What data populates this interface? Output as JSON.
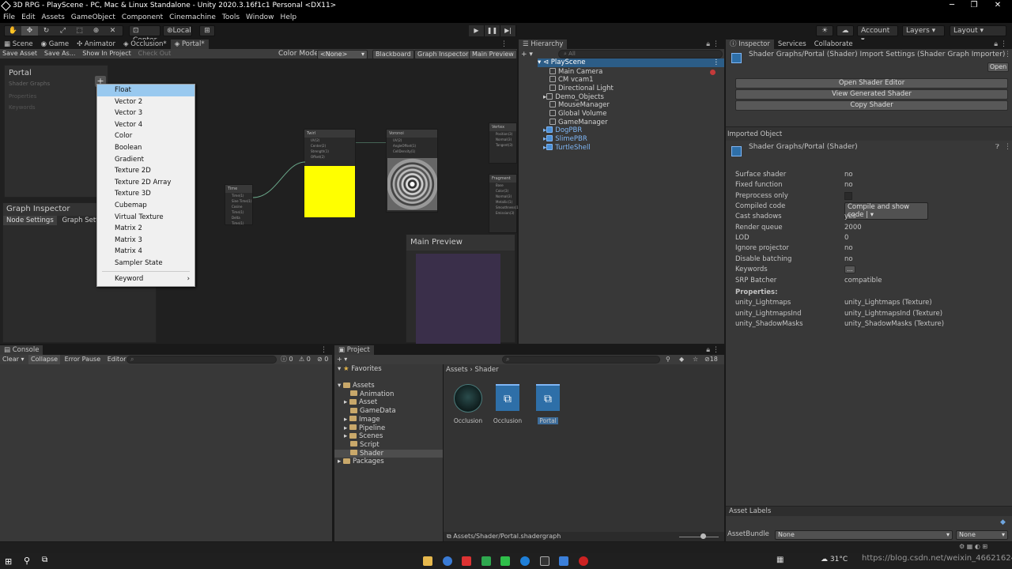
{
  "window": {
    "title": "3D RPG - PlayScene - PC, Mac & Linux Standalone - Unity 2020.3.16f1c1 Personal <DX11>",
    "controls": [
      "─",
      "❐",
      "✕"
    ]
  },
  "menu": [
    "File",
    "Edit",
    "Assets",
    "GameObject",
    "Component",
    "Cinemachine",
    "Tools",
    "Window",
    "Help"
  ],
  "toolbar": {
    "pivot": "Center",
    "space": "Local",
    "account": "Account",
    "layers": "Layers",
    "layout": "Layout"
  },
  "left_tabs": [
    "Scene",
    "Game",
    "Animator",
    "Occlusion*",
    "Portal*"
  ],
  "shader_graph": {
    "save_asset": "Save Asset",
    "save_as": "Save As...",
    "show_in_project": "Show In Project",
    "check_out": "Check Out",
    "color_mode_label": "Color Mode",
    "color_mode_value": "<None>",
    "blackboard": "Blackboard",
    "graph_inspector": "Graph Inspector",
    "main_preview": "Main Preview",
    "blackboard_title": "Portal",
    "blackboard_subtitle": "Shader Graphs",
    "blackboard_properties": "Properties",
    "blackboard_keywords": "Keywords",
    "blackboard_add": "+",
    "inspector_title": "Graph Inspector",
    "inspector_tabs": [
      "Node Settings",
      "Graph Settings"
    ],
    "main_preview_title": "Main Preview",
    "nodes": {
      "twirl": "Twirl",
      "voronoi": "Voronoi",
      "time": "Time",
      "vertex": "Vertex",
      "fragment": "Fragment"
    }
  },
  "context_menu": {
    "items": [
      "Float",
      "Vector 2",
      "Vector 3",
      "Vector 4",
      "Color",
      "Boolean",
      "Gradient",
      "Texture 2D",
      "Texture 2D Array",
      "Texture 3D",
      "Cubemap",
      "Virtual Texture",
      "Matrix 2",
      "Matrix 3",
      "Matrix 4",
      "Sampler State"
    ],
    "keyword": "Keyword",
    "keyword_arrow": "›"
  },
  "hierarchy": {
    "tab": "Hierarchy",
    "search_placeholder": "All",
    "scene": "PlayScene",
    "items": [
      "Main Camera",
      "CM vcam1",
      "Directional Light",
      "Demo_Objects",
      "MouseManager",
      "Global Volume",
      "GameManager",
      "DogPBR",
      "SlimePBR",
      "TurtleShell"
    ]
  },
  "inspector": {
    "tabs": [
      "Inspector",
      "Services",
      "Collaborate"
    ],
    "header": "Shader Graphs/Portal (Shader) Import Settings (Shader Graph Importer)",
    "open": "Open",
    "buttons": [
      "Open Shader Editor",
      "View Generated Shader",
      "Copy Shader"
    ],
    "imported_object": "Imported Object",
    "shader_title": "Shader Graphs/Portal (Shader)",
    "rows": [
      {
        "label": "Surface shader",
        "value": "no"
      },
      {
        "label": "Fixed function",
        "value": "no"
      },
      {
        "label": "Preprocess only",
        "value": ""
      },
      {
        "label": "Compiled code",
        "value": "Compile and show code"
      },
      {
        "label": "Cast shadows",
        "value": "yes"
      },
      {
        "label": "Render queue",
        "value": "2000"
      },
      {
        "label": "LOD",
        "value": "0"
      },
      {
        "label": "Ignore projector",
        "value": "no"
      },
      {
        "label": "Disable batching",
        "value": "no"
      },
      {
        "label": "Keywords",
        "value": "..."
      },
      {
        "label": "SRP Batcher",
        "value": "compatible"
      }
    ],
    "properties_label": "Properties:",
    "properties": [
      {
        "label": "unity_Lightmaps",
        "value": "unity_Lightmaps (Texture)"
      },
      {
        "label": "unity_LightmapsInd",
        "value": "unity_LightmapsInd (Texture)"
      },
      {
        "label": "unity_ShadowMasks",
        "value": "unity_ShadowMasks (Texture)"
      }
    ],
    "asset_labels": "Asset Labels",
    "asset_bundle_label": "AssetBundle",
    "asset_bundle_value": "None",
    "asset_bundle_variant": "None"
  },
  "console": {
    "tab": "Console",
    "clear": "Clear",
    "collapse": "Collapse",
    "error_pause": "Error Pause",
    "editor": "Editor",
    "counts": [
      "0",
      "0",
      "0"
    ]
  },
  "project": {
    "tab": "Project",
    "favorites": "Favorites",
    "assets": "Assets",
    "folders": [
      "Animation",
      "Asset",
      "GameData",
      "Image",
      "Pipeline",
      "Scenes",
      "Script",
      "Shader"
    ],
    "packages": "Packages",
    "breadcrumb": [
      "Assets",
      "Shader"
    ],
    "items": [
      "Occlusion",
      "Occlusion",
      "Portal"
    ],
    "status_path": "Assets/Shader/Portal.shadergraph",
    "count": "18"
  },
  "taskbar": {
    "weather": "31°C",
    "watermark": "https://blog.csdn.net/weixin_46621624"
  }
}
